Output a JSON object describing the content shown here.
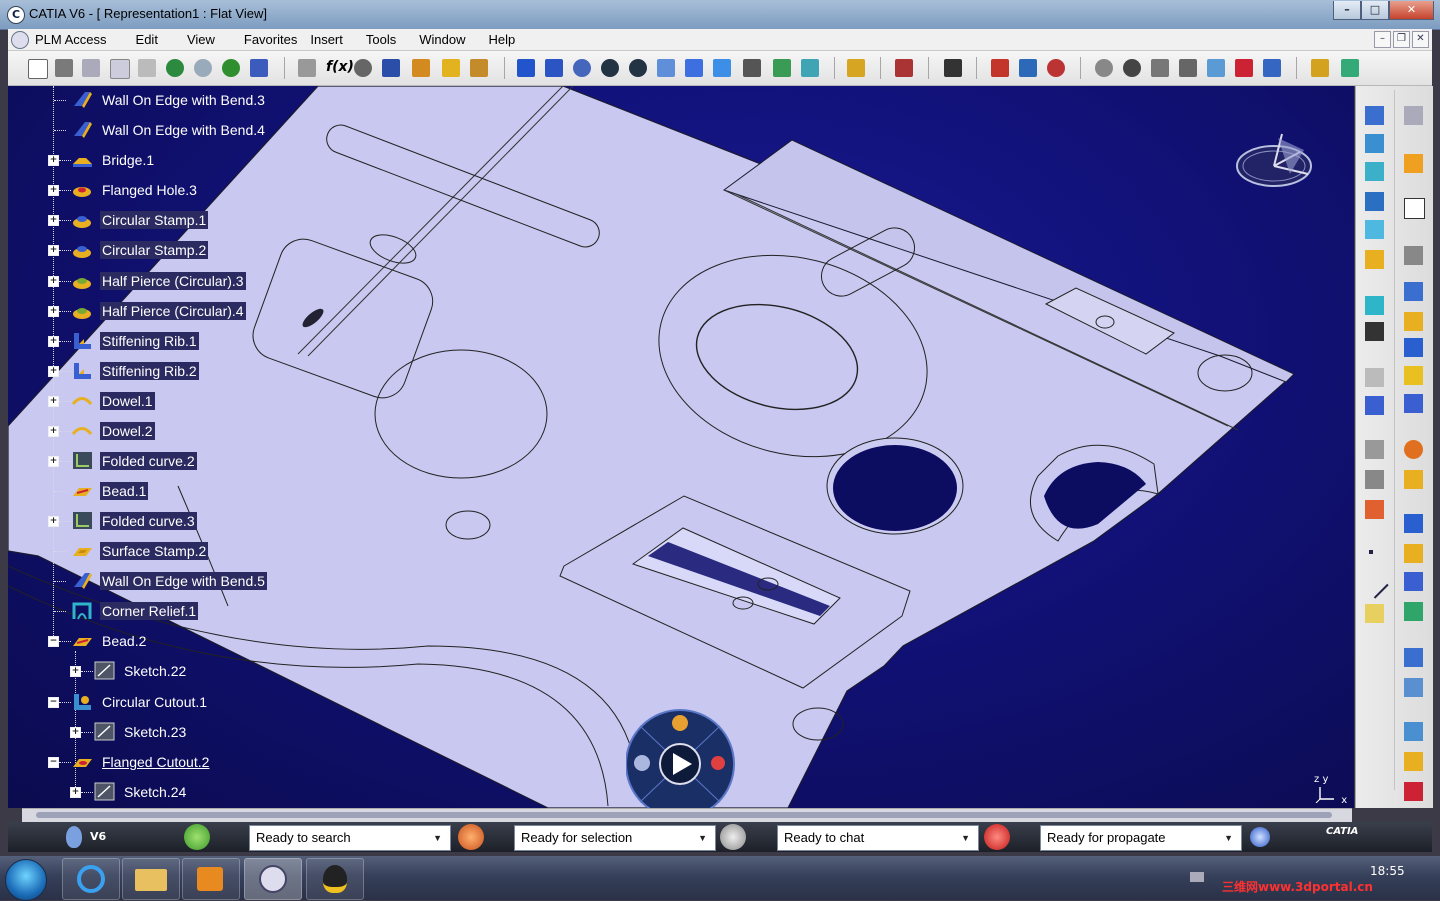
{
  "window": {
    "title": "CATIA V6 - [ Representation1 : Flat View]",
    "app_icon_glyph": "C"
  },
  "menu": {
    "items": [
      "PLM Access",
      "Edit",
      "View",
      "Favorites",
      "Insert",
      "Tools",
      "Window",
      "Help"
    ]
  },
  "tree": {
    "nodes": [
      {
        "label": "Wall On Edge with Bend.3",
        "icon": "wall-on-edge-icon",
        "expand": "",
        "style": "plain"
      },
      {
        "label": "Wall On Edge with Bend.4",
        "icon": "wall-on-edge-icon",
        "expand": "",
        "style": "plain"
      },
      {
        "label": "Bridge.1",
        "icon": "bridge-icon",
        "expand": "+",
        "style": "plain"
      },
      {
        "label": "Flanged Hole.3",
        "icon": "flanged-hole-icon",
        "expand": "+",
        "style": "plain"
      },
      {
        "label": "Circular Stamp.1",
        "icon": "circular-stamp-icon",
        "expand": "+",
        "style": "box"
      },
      {
        "label": "Circular Stamp.2",
        "icon": "circular-stamp-icon",
        "expand": "+",
        "style": "box"
      },
      {
        "label": "Half Pierce (Circular).3",
        "icon": "half-pierce-icon",
        "expand": "+",
        "style": "box"
      },
      {
        "label": "Half Pierce (Circular).4",
        "icon": "half-pierce-icon",
        "expand": "+",
        "style": "box"
      },
      {
        "label": "Stiffening Rib.1",
        "icon": "stiffening-rib-icon",
        "expand": "+",
        "style": "box"
      },
      {
        "label": "Stiffening Rib.2",
        "icon": "stiffening-rib-icon",
        "expand": "+",
        "style": "box"
      },
      {
        "label": "Dowel.1",
        "icon": "dowel-icon",
        "expand": "+",
        "style": "box"
      },
      {
        "label": "Dowel.2",
        "icon": "dowel-icon",
        "expand": "+",
        "style": "box"
      },
      {
        "label": "Folded curve.2",
        "icon": "folded-curve-icon",
        "expand": "+",
        "style": "box"
      },
      {
        "label": "Bead.1",
        "icon": "bead-icon",
        "expand": "",
        "style": "box"
      },
      {
        "label": "Folded curve.3",
        "icon": "folded-curve-icon",
        "expand": "+",
        "style": "box"
      },
      {
        "label": "Surface Stamp.2",
        "icon": "surface-stamp-icon",
        "expand": "",
        "style": "box"
      },
      {
        "label": "Wall On Edge with Bend.5",
        "icon": "wall-on-edge-icon",
        "expand": "",
        "style": "box"
      },
      {
        "label": "Corner Relief.1",
        "icon": "corner-relief-icon",
        "expand": "",
        "style": "box"
      },
      {
        "label": "Bead.2",
        "icon": "bead-icon",
        "expand": "−",
        "style": "plain"
      },
      {
        "label": "Sketch.22",
        "icon": "sketch-icon",
        "expand": "+",
        "style": "plain",
        "indent": 1
      },
      {
        "label": "Circular Cutout.1",
        "icon": "circular-cutout-icon",
        "expand": "−",
        "style": "plain"
      },
      {
        "label": "Sketch.23",
        "icon": "sketch-icon",
        "expand": "+",
        "style": "plain",
        "indent": 1
      },
      {
        "label": "Flanged Cutout.2",
        "icon": "flanged-cutout-icon",
        "expand": "−",
        "style": "link"
      },
      {
        "label": "Sketch.24",
        "icon": "sketch-icon",
        "expand": "+",
        "style": "plain",
        "indent": 1
      }
    ]
  },
  "axis_labels": {
    "z": "z",
    "y": "y",
    "x": "x"
  },
  "status": {
    "brand": "V6",
    "search": "Ready to search",
    "selection": "Ready for selection",
    "chat": "Ready to chat",
    "propagate": "Ready for propagate",
    "ds_logo": "CATIA"
  },
  "taskbar": {
    "time": "18:55",
    "watermark": "三维网www.3dportal.cn"
  },
  "colors": {
    "viewport_bg": "#11117a",
    "part_face": "#c8c8f0",
    "part_edge": "#2a2a40"
  }
}
